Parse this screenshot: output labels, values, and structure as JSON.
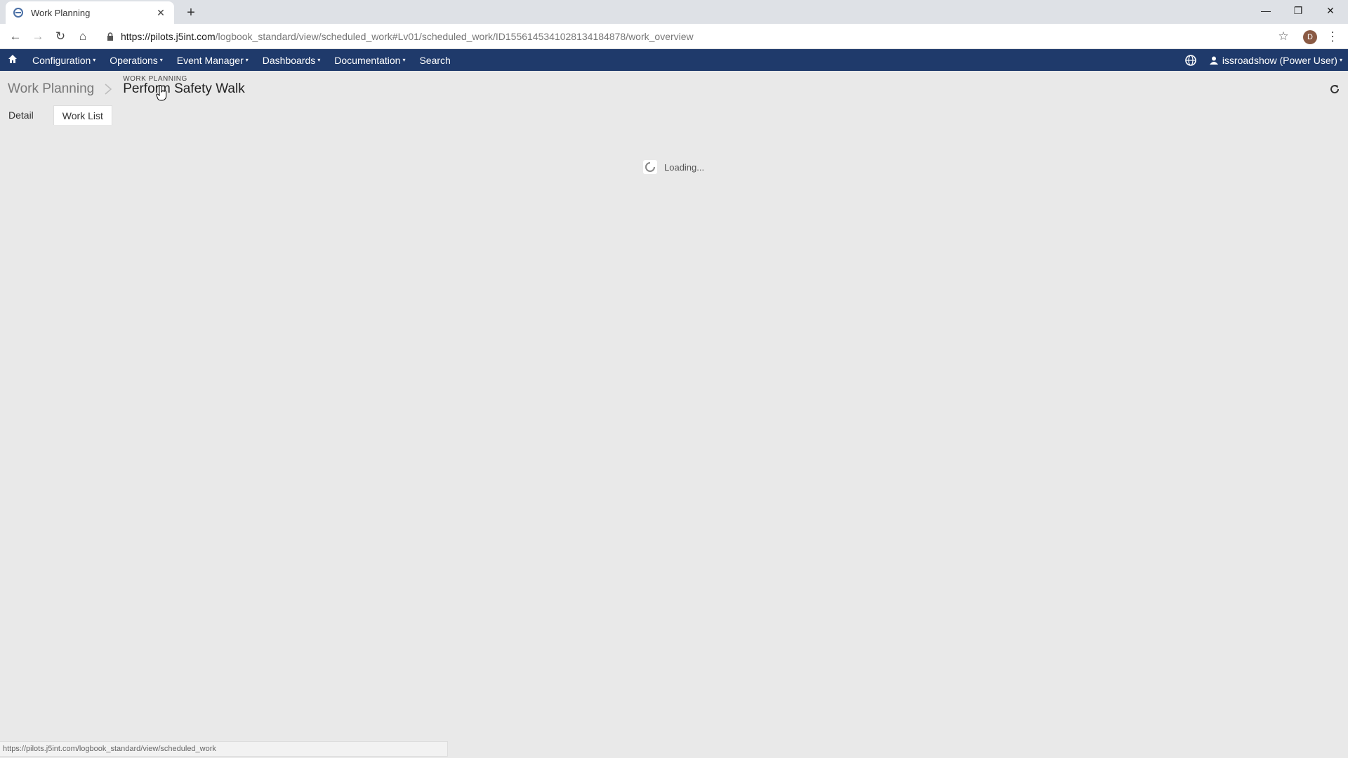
{
  "browser": {
    "tab_title": "Work Planning",
    "new_tab_icon": "plus-icon",
    "window_controls": [
      "minimize-icon",
      "restore-icon",
      "close-icon"
    ],
    "url_host": "https://pilots.j5int.com",
    "url_path": "/logbook_standard/view/scheduled_work#Lv01/scheduled_work/ID1556145341028134184878/work_overview",
    "profile_initial": "D",
    "status_url": "https://pilots.j5int.com/logbook_standard/view/scheduled_work"
  },
  "nav": {
    "items": [
      {
        "label": "Configuration",
        "has_caret": true
      },
      {
        "label": "Operations",
        "has_caret": true
      },
      {
        "label": "Event Manager",
        "has_caret": true
      },
      {
        "label": "Dashboards",
        "has_caret": true
      },
      {
        "label": "Documentation",
        "has_caret": true
      },
      {
        "label": "Search",
        "has_caret": false
      }
    ],
    "user_label": "issroadshow (Power User)",
    "caret": "▾"
  },
  "page": {
    "breadcrumb_root": "Work Planning",
    "kicker": "WORK PLANNING",
    "title": "Perform Safety Walk",
    "tabs": [
      {
        "label": "Detail",
        "active": false
      },
      {
        "label": "Work List",
        "active": true
      }
    ],
    "loading_text": "Loading..."
  },
  "colors": {
    "nav_bg": "#1f3a6b",
    "page_bg": "#e9e9e9"
  }
}
